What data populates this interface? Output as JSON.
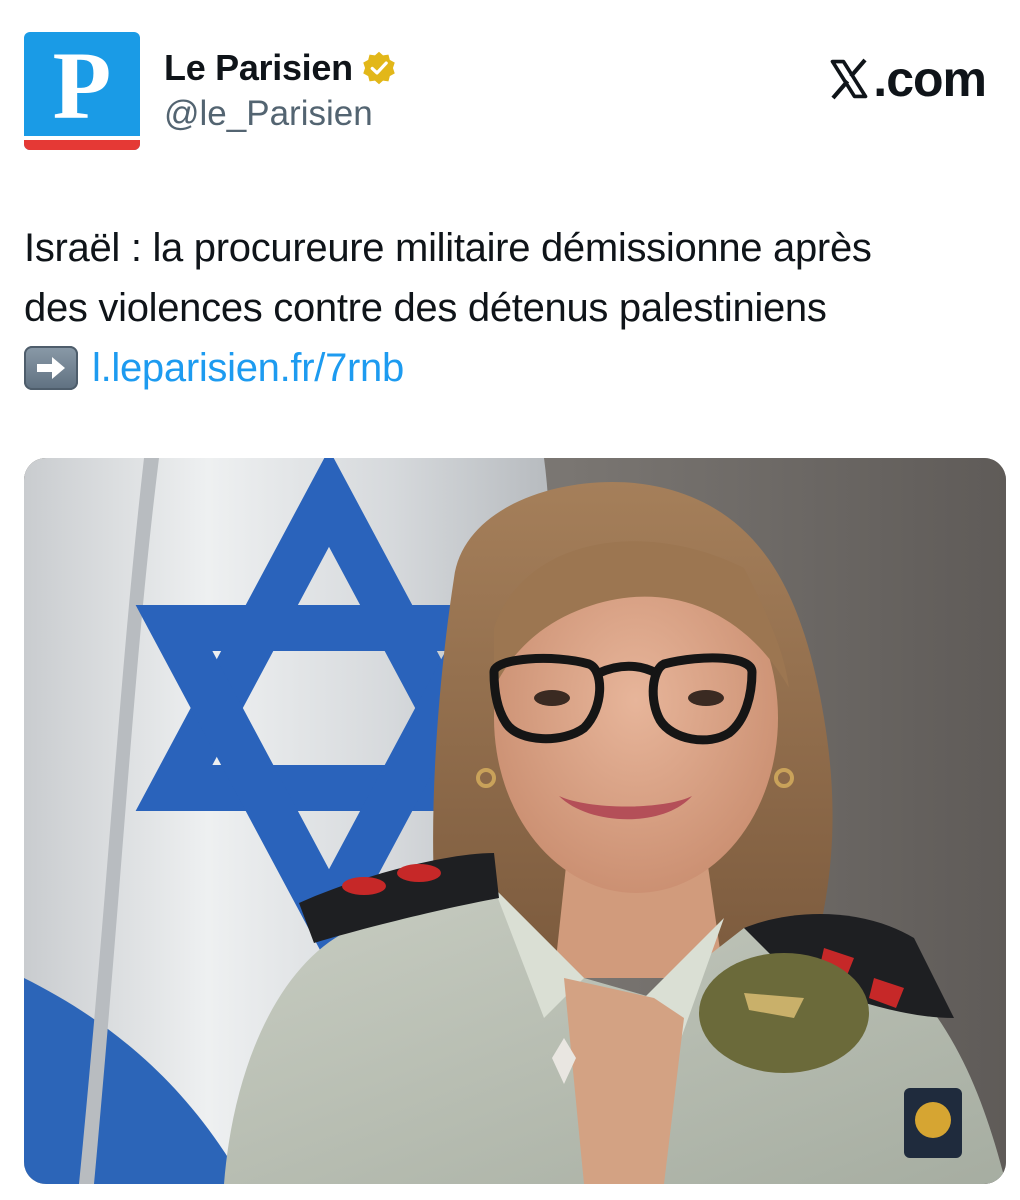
{
  "account": {
    "avatar_letter": "P",
    "display_name": "Le Parisien",
    "handle": "@le_Parisien",
    "verified_icon": "verified-gold-badge-icon",
    "brand_color": "#1a9be6",
    "brand_accent": "#e53935"
  },
  "platform": {
    "icon": "x-logo-icon",
    "label": ".com"
  },
  "tweet": {
    "line1": "Israël : la procureure militaire démissionne après",
    "line2": "des violences contre des détenus palestiniens",
    "arrow_icon": "right-arrow-emoji-icon",
    "link_text": "l.leparisien.fr/7rnb",
    "link_color": "#1d9bf0"
  },
  "media": {
    "kind": "photo"
  }
}
